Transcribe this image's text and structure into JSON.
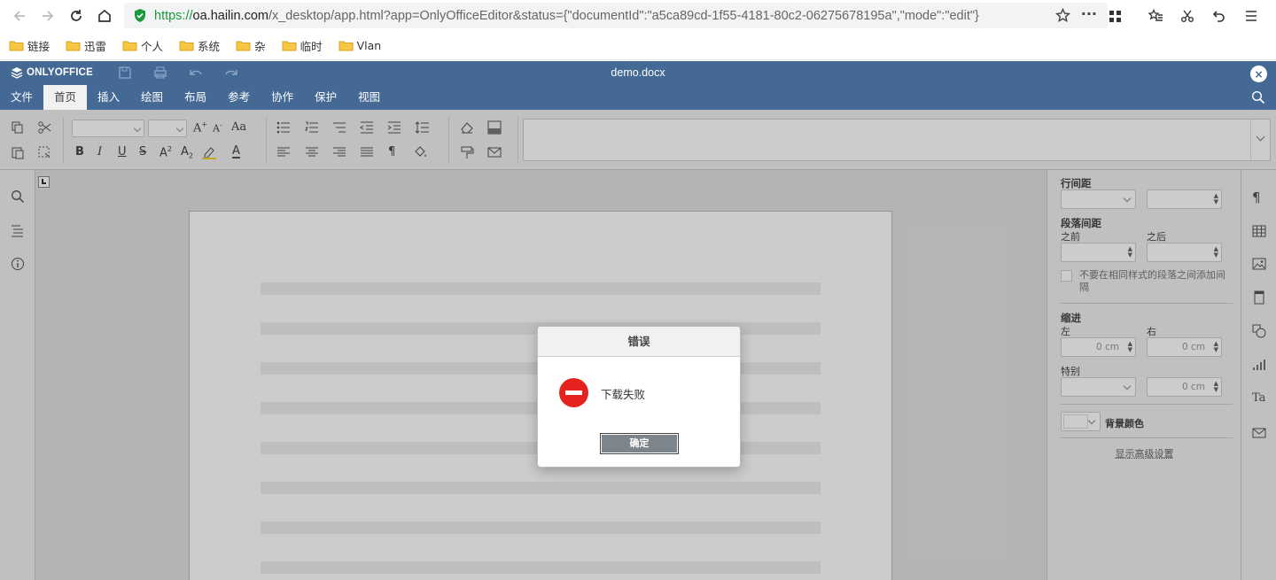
{
  "browser": {
    "url_protocol": "https://",
    "url_host": "oa.hailin.com",
    "url_rest": "/x_desktop/app.html?app=OnlyOfficeEditor&status={\"documentId\":\"a5ca89cd-1f55-4181-80c2-06275678195a\",\"mode\":\"edit\"}",
    "bookmarks": [
      "链接",
      "迅雷",
      "个人",
      "系统",
      "杂",
      "临时",
      "Vlan"
    ]
  },
  "editor": {
    "logo": "ONLYOFFICE",
    "doc_title": "demo.docx",
    "tabs": [
      "文件",
      "首页",
      "插入",
      "绘图",
      "布局",
      "参考",
      "协作",
      "保护",
      "视图"
    ],
    "active_tab": "首页"
  },
  "right_panel": {
    "line_spacing": "行间距",
    "para_spacing": "段落间距",
    "before": "之前",
    "after": "之后",
    "no_space_same_style": "不要在相同样式的段落之间添加间隔",
    "indent": "缩进",
    "left": "左",
    "right": "右",
    "left_value": "0 cm",
    "right_value": "0 cm",
    "special": "特别",
    "special_value": "0 cm",
    "bg_color": "背景颜色",
    "advanced": "显示高级设置"
  },
  "dialog": {
    "title": "错误",
    "message": "下载失败",
    "ok": "确定"
  },
  "colors": {
    "header": "#446995",
    "error": "#e5231e",
    "url_secure": "#1b9a3c"
  }
}
